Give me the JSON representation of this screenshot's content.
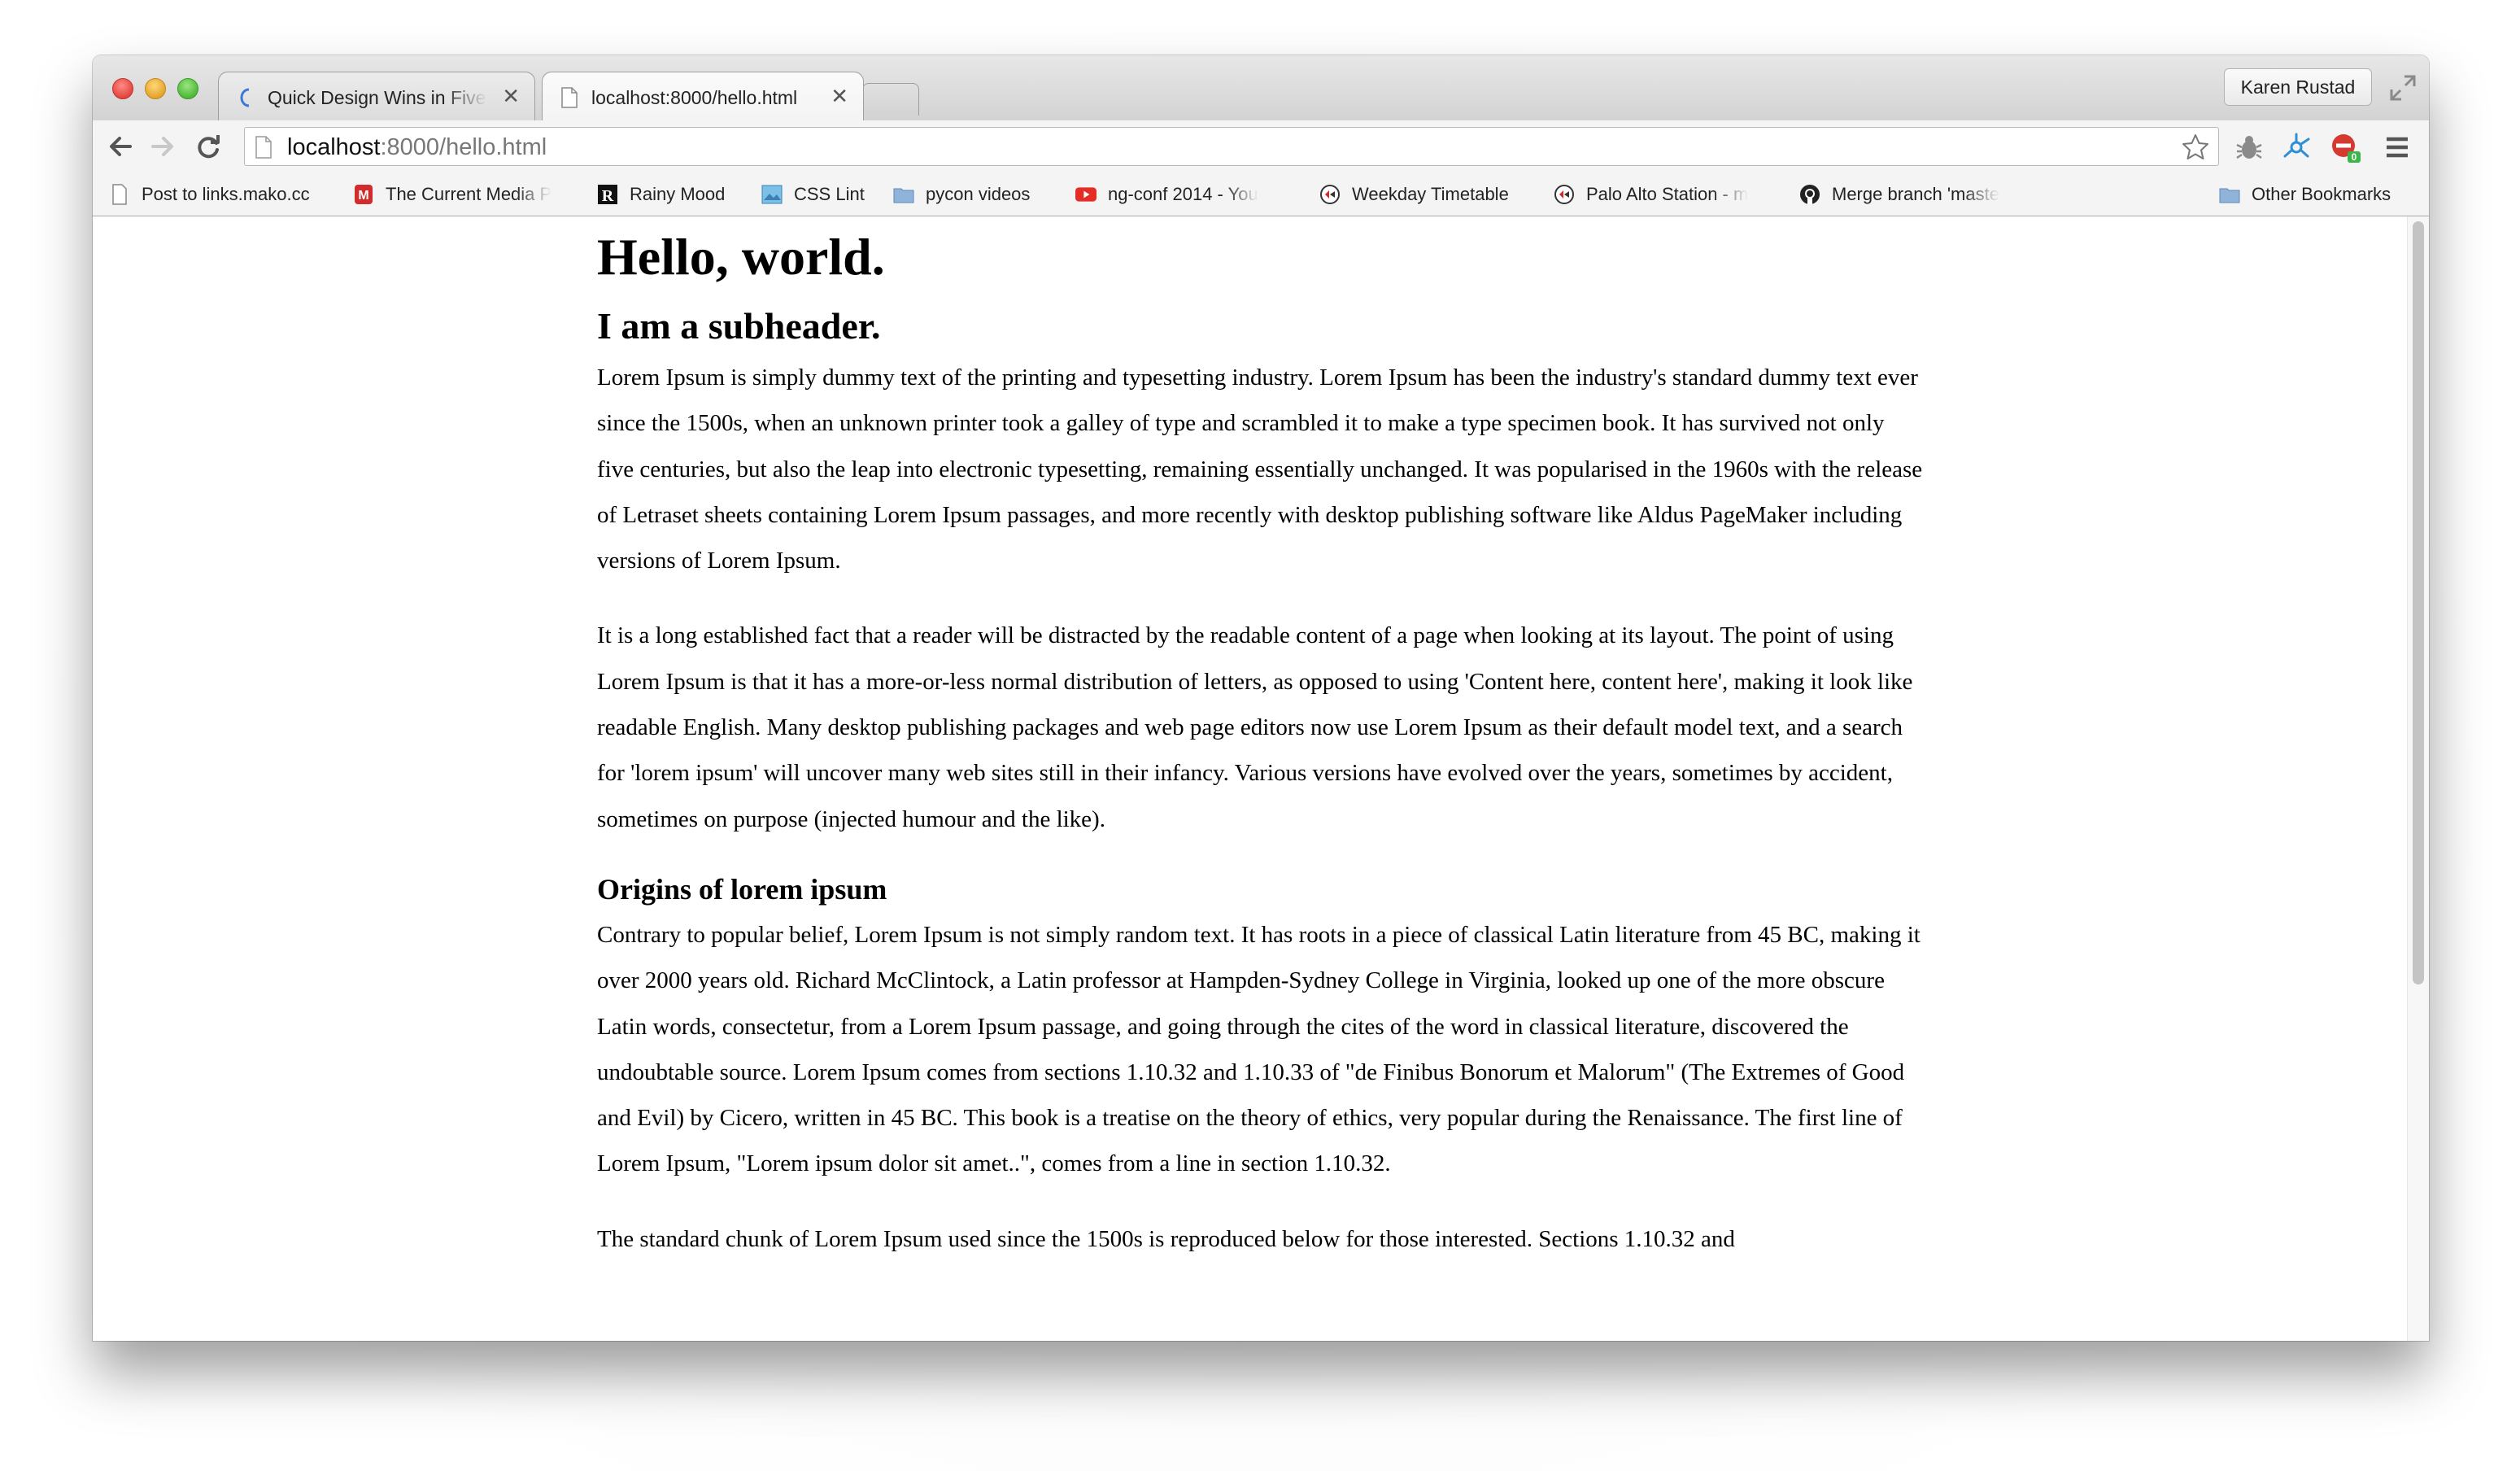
{
  "browser": {
    "tabs": [
      {
        "title": "Quick Design Wins in Five",
        "active": false
      },
      {
        "title": "localhost:8000/hello.html",
        "active": true
      }
    ],
    "profile_name": "Karen Rustad",
    "url_host": "localhost",
    "url_rest": ":8000/hello.html",
    "extension_badge": "0"
  },
  "bookmarks": [
    {
      "label": "Post to links.mako.cc",
      "icon": "page-icon"
    },
    {
      "label": "The Current Media P",
      "icon": "tumblr-icon"
    },
    {
      "label": "Rainy Mood",
      "icon": "rainy-mood-icon"
    },
    {
      "label": "CSS Lint",
      "icon": "css-lint-icon"
    },
    {
      "label": "pycon videos",
      "icon": "folder-icon"
    },
    {
      "label": "ng-conf 2014 - You",
      "icon": "youtube-icon"
    },
    {
      "label": "Weekday Timetable",
      "icon": "caltrain-icon"
    },
    {
      "label": "Palo Alto Station - m",
      "icon": "caltrain-icon"
    },
    {
      "label": "Merge branch 'maste",
      "icon": "github-icon"
    }
  ],
  "other_bookmarks": "Other Bookmarks",
  "page": {
    "h1": "Hello, world.",
    "h2": "I am a subheader.",
    "p1": "Lorem Ipsum is simply dummy text of the printing and typesetting industry. Lorem Ipsum has been the industry's standard dummy text ever since the 1500s, when an unknown printer took a galley of type and scrambled it to make a type specimen book. It has survived not only five centuries, but also the leap into electronic typesetting, remaining essentially unchanged. It was popularised in the 1960s with the release of Letraset sheets containing Lorem Ipsum passages, and more recently with desktop publishing software like Aldus PageMaker including versions of Lorem Ipsum.",
    "p2": "It is a long established fact that a reader will be distracted by the readable content of a page when looking at its layout. The point of using Lorem Ipsum is that it has a more-or-less normal distribution of letters, as opposed to using 'Content here, content here', making it look like readable English. Many desktop publishing packages and web page editors now use Lorem Ipsum as their default model text, and a search for 'lorem ipsum' will uncover many web sites still in their infancy. Various versions have evolved over the years, sometimes by accident, sometimes on purpose (injected humour and the like).",
    "h3": "Origins of lorem ipsum",
    "p3": "Contrary to popular belief, Lorem Ipsum is not simply random text. It has roots in a piece of classical Latin literature from 45 BC, making it over 2000 years old. Richard McClintock, a Latin professor at Hampden-Sydney College in Virginia, looked up one of the more obscure Latin words, consectetur, from a Lorem Ipsum passage, and going through the cites of the word in classical literature, discovered the undoubtable source. Lorem Ipsum comes from sections 1.10.32 and 1.10.33 of \"de Finibus Bonorum et Malorum\" (The Extremes of Good and Evil) by Cicero, written in 45 BC. This book is a treatise on the theory of ethics, very popular during the Renaissance. The first line of Lorem Ipsum, \"Lorem ipsum dolor sit amet..\", comes from a line in section 1.10.32.",
    "p4": "The standard chunk of Lorem Ipsum used since the 1500s is reproduced below for those interested. Sections 1.10.32 and"
  },
  "colors": {
    "youtube": "#e52d27",
    "tumblr": "#d12b2b",
    "folder": "#8fb3d9",
    "github": "#222222",
    "ext_badge": "#3cb64a"
  }
}
